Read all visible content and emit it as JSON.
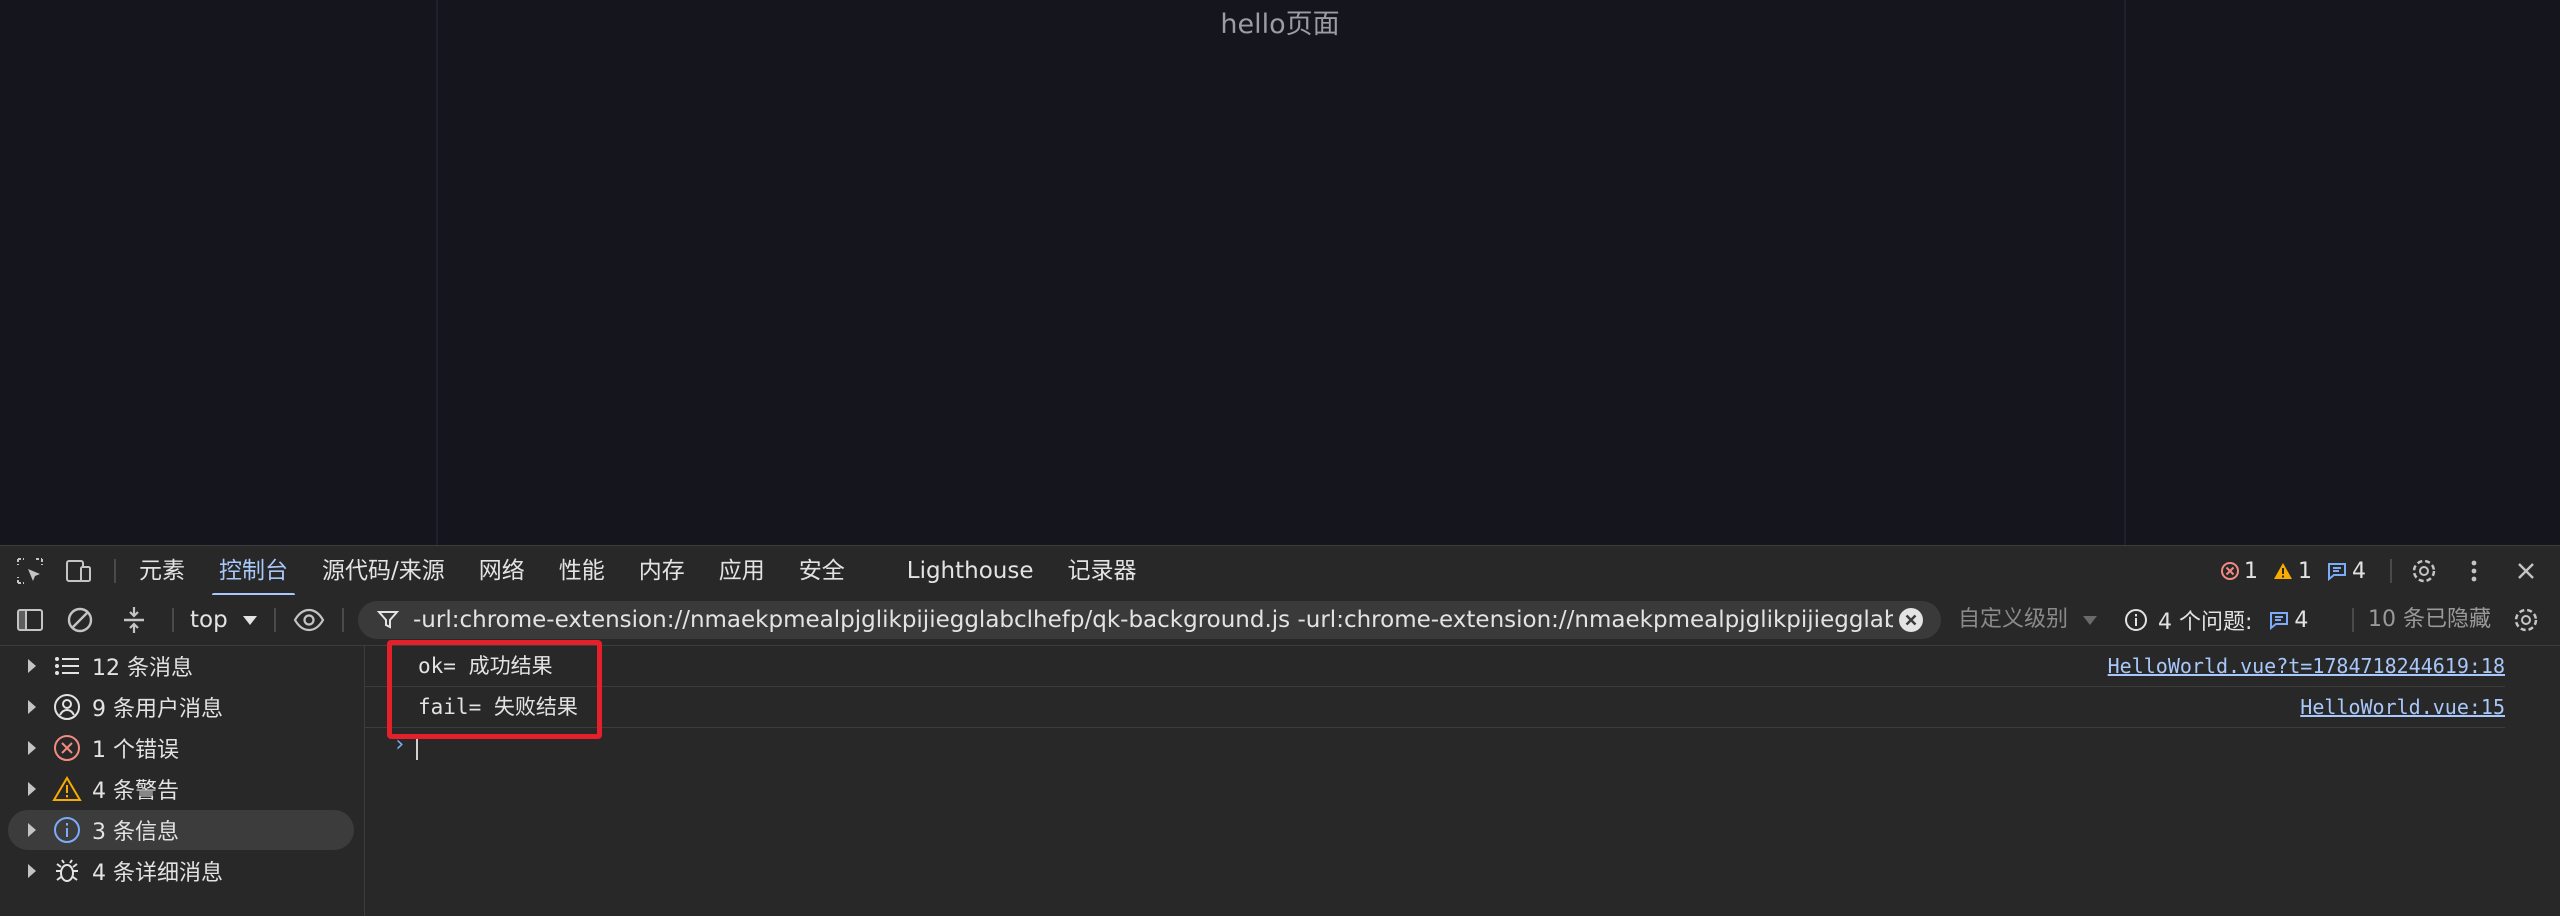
{
  "page": {
    "title": "hello页面"
  },
  "devtools": {
    "tabs": [
      {
        "label": "元素",
        "active": false
      },
      {
        "label": "控制台",
        "active": true
      },
      {
        "label": "源代码/来源",
        "active": false
      },
      {
        "label": "网络",
        "active": false
      },
      {
        "label": "性能",
        "active": false
      },
      {
        "label": "内存",
        "active": false
      },
      {
        "label": "应用",
        "active": false
      },
      {
        "label": "安全",
        "active": false
      },
      {
        "label": "Lighthouse",
        "active": false
      },
      {
        "label": "记录器",
        "active": false
      }
    ],
    "counts": {
      "errors": "1",
      "warnings": "1",
      "messages": "4"
    }
  },
  "toolbar": {
    "context": "top",
    "filter": "-url:chrome-extension://nmaekpmealpjglikpijiegglabclhefp/qk-background.js -url:chrome-extension://nmaekpmealpjglikpijiegglabclhefp/c",
    "level": "自定义级别",
    "issues_label": "4 个问题:",
    "issues_count": "4",
    "hidden": "10 条已隐藏"
  },
  "sidebar": {
    "items": [
      {
        "label": "12 条消息",
        "icon": "list-icon"
      },
      {
        "label": "9 条用户消息",
        "icon": "user-icon"
      },
      {
        "label": "1 个错误",
        "icon": "error-icon"
      },
      {
        "label": "4 条警告",
        "icon": "warning-icon"
      },
      {
        "label": "3 条信息",
        "icon": "info-icon",
        "selected": true
      },
      {
        "label": "4 条详细消息",
        "icon": "bug-icon"
      }
    ]
  },
  "console": {
    "messages": [
      {
        "text": "ok= 成功结果",
        "source": "HelloWorld.vue?t=1784718244619:18"
      },
      {
        "text": "fail= 失败结果",
        "source": "HelloWorld.vue:15"
      }
    ],
    "prompt": "›"
  },
  "colors": {
    "accent": "#a8c7fa",
    "highlight": "#e5202a",
    "error": "#f28b82",
    "warning": "#f9ab00"
  }
}
